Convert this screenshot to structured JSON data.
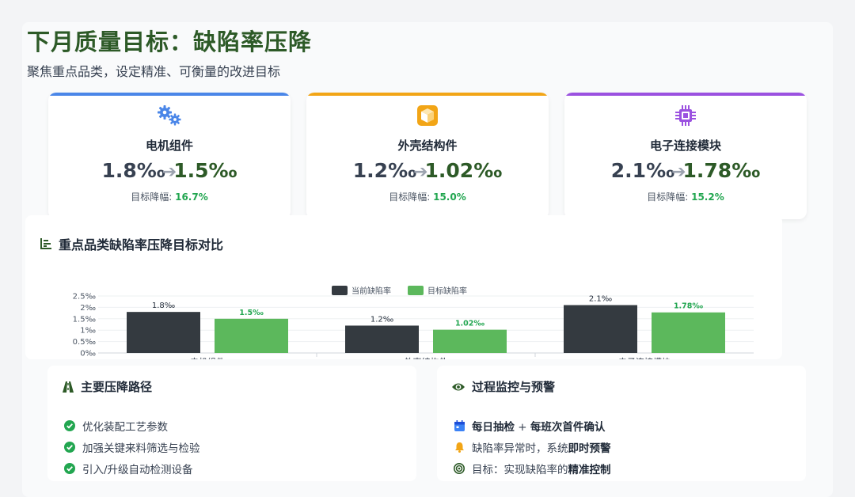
{
  "header": {
    "title": "下月质量目标：缺陷率压降",
    "subtitle": "聚焦重点品类，设定精准、可衡量的改进目标"
  },
  "cards": [
    {
      "name": "电机组件",
      "current": "1.8‰",
      "target": "1.5‰",
      "reduction_label": "目标降幅:",
      "reduction": "16.7%",
      "accent": "#4a86e8",
      "icon": "gears-icon"
    },
    {
      "name": "外壳结构件",
      "current": "1.2‰",
      "target": "1.02‰",
      "reduction_label": "目标降幅:",
      "reduction": "15.0%",
      "accent": "#f2a516",
      "icon": "cube-icon"
    },
    {
      "name": "电子连接模块",
      "current": "2.1‰",
      "target": "1.78‰",
      "reduction_label": "目标降幅:",
      "reduction": "15.2%",
      "accent": "#9b51e0",
      "icon": "chip-icon"
    }
  ],
  "chart_data": {
    "type": "bar",
    "title": "重点品类缺陷率压降目标对比",
    "categories": [
      "电机组件",
      "外壳结构件",
      "电子连接模块"
    ],
    "series": [
      {
        "name": "当前缺陷率",
        "values": [
          1.8,
          1.2,
          2.1
        ],
        "labels": [
          "1.8‰",
          "1.2‰",
          "2.1‰"
        ],
        "color": "#343a40"
      },
      {
        "name": "目标缺陷率",
        "values": [
          1.5,
          1.02,
          1.78
        ],
        "labels": [
          "1.5‰",
          "1.02‰",
          "1.78‰"
        ],
        "color": "#5cb85c"
      }
    ],
    "yticks": [
      "0‰",
      "0.5‰",
      "1‰",
      "1.5‰",
      "2‰",
      "2.5‰"
    ],
    "ylim": [
      0,
      2.5
    ],
    "grid": true,
    "legend": "top-center",
    "label_color_target": "#22a650"
  },
  "panels": {
    "paths": {
      "title": "主要压降路径",
      "items": [
        "优化装配工艺参数",
        "加强关键来料筛选与检验",
        "引入/升级自动检测设备"
      ],
      "check_color": "#22a650"
    },
    "monitor": {
      "title": "过程监控与预警",
      "items": [
        {
          "pre": "",
          "bold": "每日抽检",
          "mid": " + ",
          "bold2": "每班次首件确认",
          "post": "",
          "icon": "calendar-icon"
        },
        {
          "pre": "缺陷率异常时，系统",
          "bold": "即时预警",
          "mid": "",
          "bold2": "",
          "post": "",
          "icon": "bell-icon"
        },
        {
          "pre": "目标：实现缺陷率的",
          "bold": "精准控制",
          "mid": "",
          "bold2": "",
          "post": "",
          "icon": "target-icon"
        }
      ]
    }
  }
}
